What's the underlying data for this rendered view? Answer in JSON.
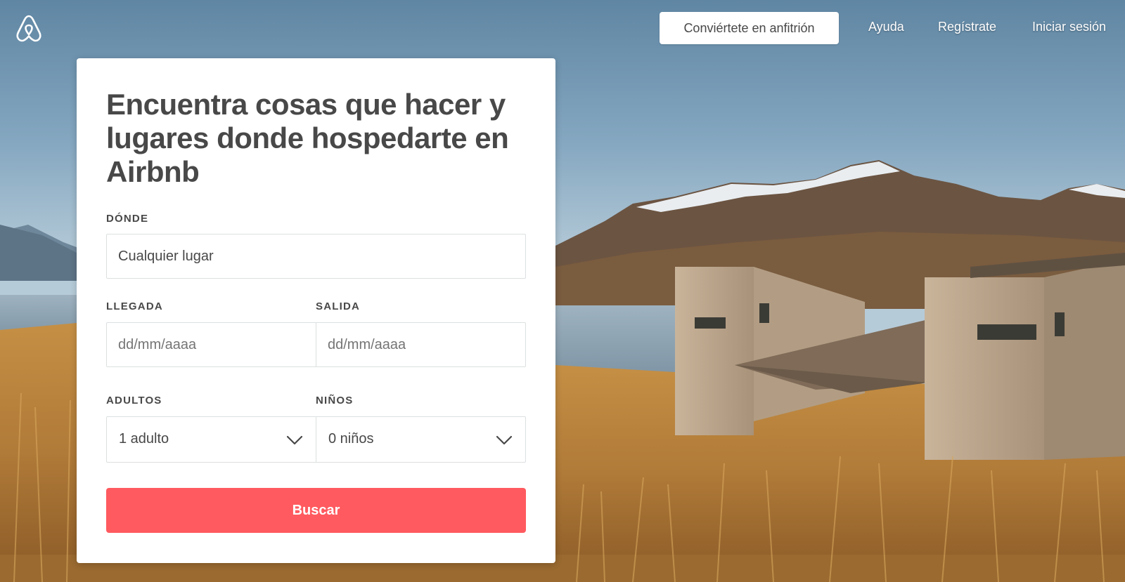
{
  "header": {
    "logo_icon": "airbnb-belo-logo-icon",
    "host_button": "Conviértete en anfitrión",
    "help": "Ayuda",
    "signup": "Regístrate",
    "login": "Iniciar sesión"
  },
  "search_card": {
    "headline": "Encuentra cosas que hacer y lugares donde hospedarte en Airbnb",
    "where": {
      "label": "DÓNDE",
      "value": "Cualquier lugar"
    },
    "checkin": {
      "label": "LLEGADA",
      "placeholder": "dd/mm/aaaa"
    },
    "checkout": {
      "label": "SALIDA",
      "placeholder": "dd/mm/aaaa"
    },
    "adults": {
      "label": "ADULTOS",
      "value": "1 adulto",
      "icon": "chevron-down-icon"
    },
    "children": {
      "label": "NIÑOS",
      "value": "0 niños",
      "icon": "chevron-down-icon"
    },
    "search_button": "Buscar"
  },
  "colors": {
    "brand": "#ff5a5f",
    "text": "#484848",
    "border": "#dce0e0"
  }
}
